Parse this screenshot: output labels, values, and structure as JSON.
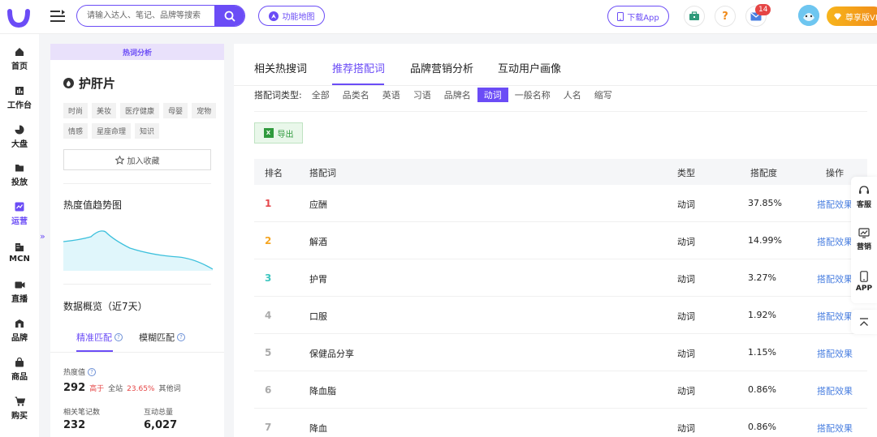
{
  "header": {
    "search_placeholder": "请输入达人、笔记、品牌等搜索",
    "func_map_label": "功能地图",
    "download_app_label": "下载App",
    "mail_badge": "14",
    "vip_label": "尊享版VIP"
  },
  "leftnav": {
    "items": [
      {
        "label": "首页",
        "icon": "home-icon"
      },
      {
        "label": "工作台",
        "icon": "workbench-icon"
      },
      {
        "label": "大盘",
        "icon": "pie-icon"
      },
      {
        "label": "投放",
        "icon": "folder-icon"
      },
      {
        "label": "运营",
        "icon": "chart-icon"
      },
      {
        "label": "MCN",
        "icon": "building-icon"
      },
      {
        "label": "直播",
        "icon": "video-icon"
      },
      {
        "label": "品牌",
        "icon": "brand-icon"
      },
      {
        "label": "商品",
        "icon": "bag-icon"
      },
      {
        "label": "购买",
        "icon": "cart-icon"
      }
    ],
    "active_index": 4,
    "collapse_label": "»"
  },
  "info": {
    "header": "热词分析",
    "keyword": "护肝片",
    "tags": [
      "时尚",
      "美妆",
      "医疗健康",
      "母婴",
      "宠物",
      "情感",
      "星座命理",
      "知识"
    ],
    "fav_label": "加入收藏",
    "trend_title": "热度值趋势图",
    "overview_title": "数据概览（近7天）",
    "match_tabs": [
      "精准匹配",
      "模糊匹配"
    ],
    "heat_label": "热度值",
    "heat_value": "292",
    "heat_compare_prefix": "高于",
    "heat_compare_mid": "全站",
    "heat_compare_pct": "23.65%",
    "heat_compare_suffix": "其他词",
    "notes_label": "相关笔记数",
    "notes_value": "232",
    "interact_label": "互动总量",
    "interact_value": "6,027"
  },
  "main": {
    "tabs": [
      "相关热搜词",
      "推荐搭配词",
      "品牌营销分析",
      "互动用户画像"
    ],
    "active_tab": 1,
    "filter_label": "搭配词类型:",
    "filters": [
      "全部",
      "品类名",
      "英语",
      "习语",
      "品牌名",
      "动词",
      "一般名称",
      "人名",
      "缩写"
    ],
    "active_filter": 5,
    "export_label": "导出",
    "columns": [
      "排名",
      "搭配词",
      "类型",
      "搭配度",
      "操作"
    ],
    "rows": [
      {
        "rank": "1",
        "word": "应酬",
        "type": "动词",
        "degree": "37.85%",
        "action": "搭配效果"
      },
      {
        "rank": "2",
        "word": "解酒",
        "type": "动词",
        "degree": "14.99%",
        "action": "搭配效果"
      },
      {
        "rank": "3",
        "word": "护胃",
        "type": "动词",
        "degree": "3.27%",
        "action": "搭配效果"
      },
      {
        "rank": "4",
        "word": "口服",
        "type": "动词",
        "degree": "1.92%",
        "action": "搭配效果"
      },
      {
        "rank": "5",
        "word": "保健品分享",
        "type": "动词",
        "degree": "1.15%",
        "action": "搭配效果"
      },
      {
        "rank": "6",
        "word": "降血脂",
        "type": "动词",
        "degree": "0.86%",
        "action": "搭配效果"
      },
      {
        "rank": "7",
        "word": "降血",
        "type": "动词",
        "degree": "0.86%",
        "action": "搭配效果"
      }
    ],
    "rank_colors": [
      "#e5484d",
      "#f5a623",
      "#3fc6c0",
      "#aaaaaa",
      "#aaaaaa",
      "#aaaaaa",
      "#aaaaaa"
    ]
  },
  "float": {
    "service": "客服",
    "marketing": "营销",
    "app": "APP"
  },
  "colors": {
    "accent": "#6b4cf6",
    "link": "#4a7fe0",
    "export_green": "#2f9a3d"
  }
}
